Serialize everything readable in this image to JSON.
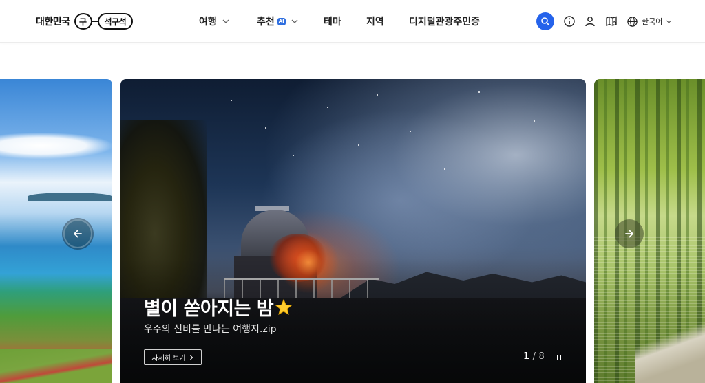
{
  "header": {
    "logo": {
      "text": "대한민국",
      "mark": "구",
      "pill": "석구석"
    },
    "nav": [
      {
        "label": "여행",
        "has_dropdown": true
      },
      {
        "label": "추천",
        "badge": "AI",
        "has_dropdown": true
      },
      {
        "label": "테마",
        "has_dropdown": false
      },
      {
        "label": "지역",
        "has_dropdown": false
      },
      {
        "label": "디지털관광주민증",
        "has_dropdown": false
      }
    ],
    "utility_icons": [
      "search-icon",
      "info-icon",
      "user-icon",
      "map-icon",
      "globe-icon"
    ],
    "language": "한국어",
    "accent_color": "#2563eb"
  },
  "carousel": {
    "active_slide": {
      "title": "별이 쏟아지는 밤",
      "title_icon": "star-emoji-icon",
      "subtitle": "우주의 신비를 만나는 여행지.zip",
      "cta_label": "자세히 보기"
    },
    "pager": {
      "current": "1",
      "separator": "/",
      "total": "8"
    },
    "controls": [
      "arrow-left-icon",
      "arrow-right-icon",
      "pause-icon"
    ]
  }
}
